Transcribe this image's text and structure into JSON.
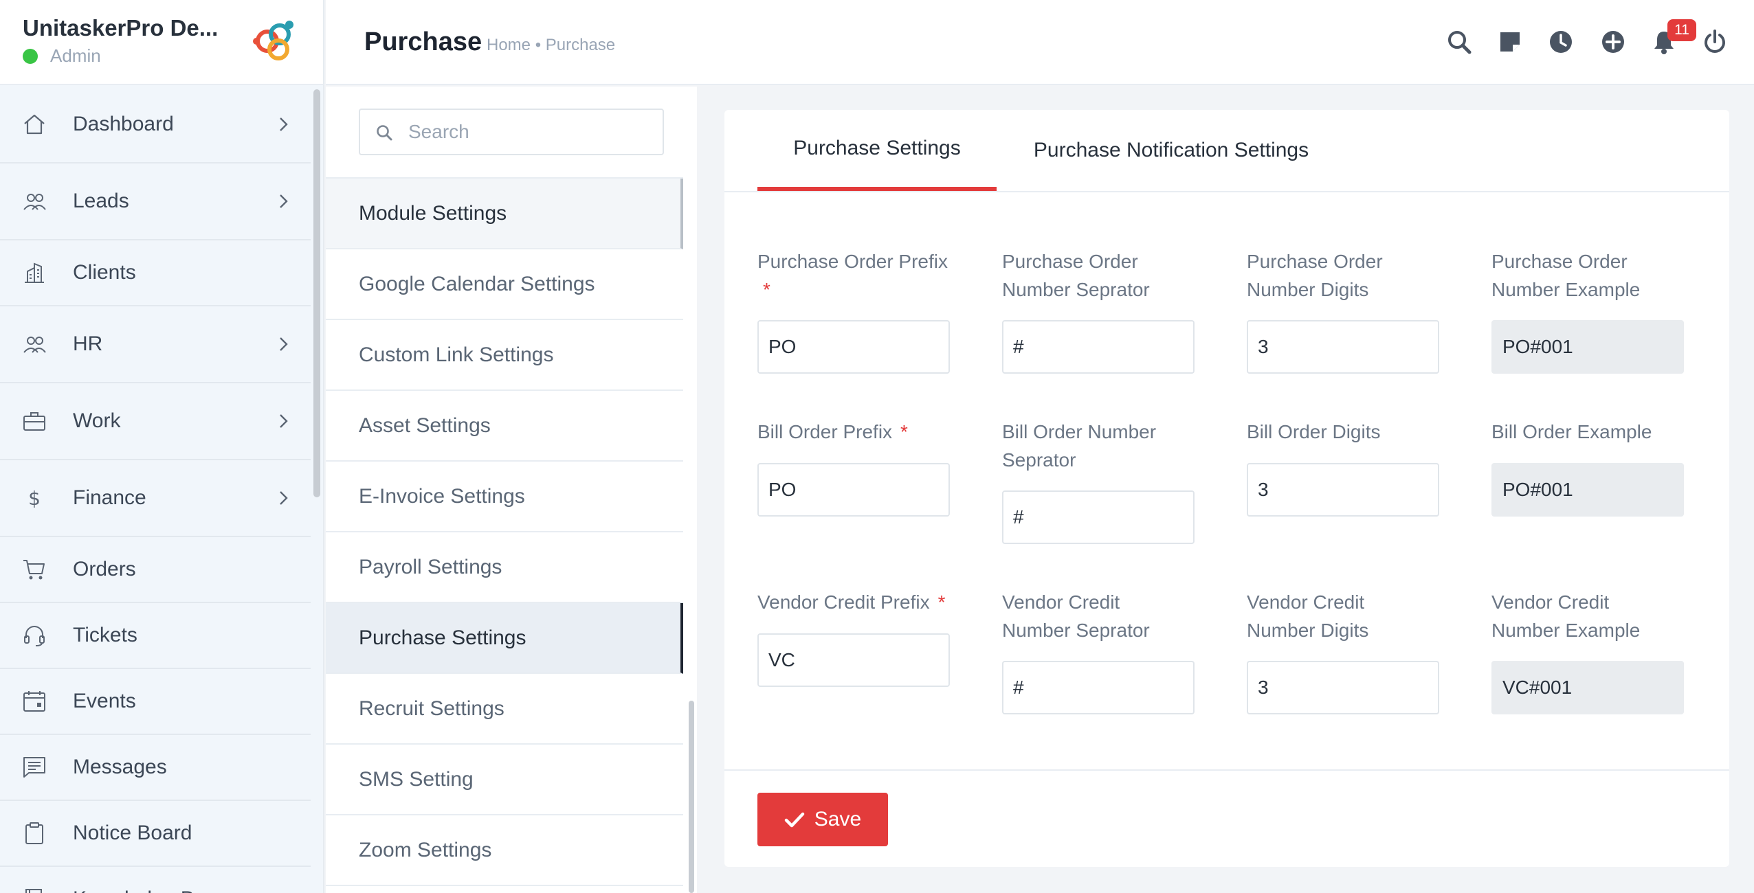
{
  "brand": {
    "name": "UnitaskerPro De...",
    "role": "Admin"
  },
  "sidebar": {
    "items": [
      {
        "label": "Dashboard",
        "icon": "home-icon",
        "chevron": true
      },
      {
        "label": "Leads",
        "icon": "users-icon",
        "chevron": true
      },
      {
        "label": "Clients",
        "icon": "building-icon",
        "chevron": false
      },
      {
        "label": "HR",
        "icon": "users-icon",
        "chevron": true
      },
      {
        "label": "Work",
        "icon": "briefcase-icon",
        "chevron": true
      },
      {
        "label": "Finance",
        "icon": "dollar-icon",
        "chevron": true
      },
      {
        "label": "Orders",
        "icon": "cart-icon",
        "chevron": false
      },
      {
        "label": "Tickets",
        "icon": "headset-icon",
        "chevron": false
      },
      {
        "label": "Events",
        "icon": "calendar-icon",
        "chevron": false
      },
      {
        "label": "Messages",
        "icon": "message-icon",
        "chevron": false
      },
      {
        "label": "Notice Board",
        "icon": "clipboard-icon",
        "chevron": false
      },
      {
        "label": "Knowledge Base",
        "icon": "book-icon",
        "chevron": false
      }
    ]
  },
  "header": {
    "title": "Purchase",
    "breadcrumb": "Home • Purchase",
    "notification_count": "11",
    "icons": [
      "search-icon",
      "sticky-note-icon",
      "clock-icon",
      "plus-circle-icon",
      "bell-icon",
      "power-icon"
    ]
  },
  "settings": {
    "search_placeholder": "Search",
    "items": [
      "Module Settings",
      "Google Calendar Settings",
      "Custom Link Settings",
      "Asset Settings",
      "E-Invoice Settings",
      "Payroll Settings",
      "Purchase Settings",
      "Recruit Settings",
      "SMS Setting",
      "Zoom Settings"
    ],
    "active": "Purchase Settings"
  },
  "tabs": {
    "purchase_settings": "Purchase Settings",
    "notification_settings": "Purchase Notification Settings"
  },
  "form": {
    "po_prefix_label": "Purchase Order Prefix",
    "po_prefix_value": "PO",
    "po_separator_label_1": "Purchase Order",
    "po_separator_label_2": "Number Seprator",
    "po_separator_value": "#",
    "po_digits_label_1": "Purchase Order",
    "po_digits_label_2": "Number Digits",
    "po_digits_value": "3",
    "po_example_label_1": "Purchase Order",
    "po_example_label_2": "Number Example",
    "po_example_value": "PO#001",
    "bill_prefix_label": "Bill Order Prefix",
    "bill_prefix_value": "PO",
    "bill_separator_label_1": "Bill Order Number",
    "bill_separator_label_2": "Seprator",
    "bill_separator_value": "#",
    "bill_digits_label": "Bill Order Digits",
    "bill_digits_value": "3",
    "bill_example_label": "Bill Order Example",
    "bill_example_value": "PO#001",
    "vc_prefix_label": "Vendor Credit Prefix",
    "vc_prefix_value": "VC",
    "vc_separator_label_1": "Vendor Credit",
    "vc_separator_label_2": "Number Seprator",
    "vc_separator_value": "#",
    "vc_digits_label_1": "Vendor Credit",
    "vc_digits_label_2": "Number Digits",
    "vc_digits_value": "3",
    "vc_example_label_1": "Vendor Credit",
    "vc_example_label_2": "Number Example",
    "vc_example_value": "VC#001",
    "required_mark": "*"
  },
  "actions": {
    "save_label": "Save"
  },
  "colors": {
    "accent": "#e33b3b",
    "online": "#39c545"
  }
}
